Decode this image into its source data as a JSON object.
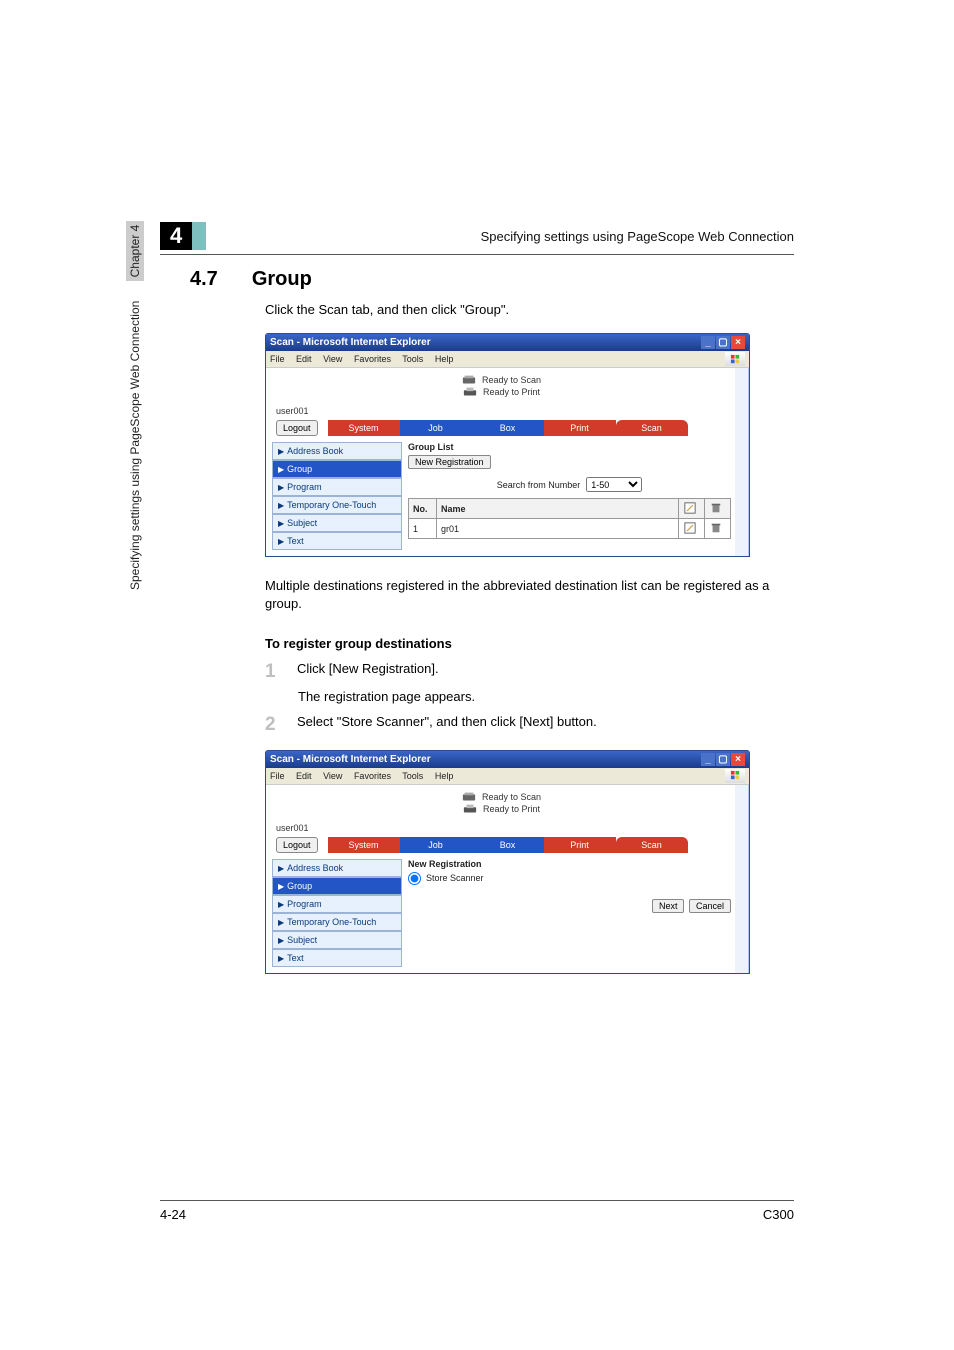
{
  "page": {
    "chapter_num": "4",
    "header_title": "Specifying settings using PageScope Web Connection",
    "footer_left": "4-24",
    "footer_right": "C300",
    "side_tab_text": "Specifying settings using PageScope Web Connection",
    "side_chapter": "Chapter 4"
  },
  "section": {
    "num": "4.7",
    "title": "Group",
    "intro": "Click the Scan tab, and then click \"Group\".",
    "mid_text": "Multiple destinations registered in the abbreviated destination list can be registered as a group.",
    "subhead": "To register group destinations",
    "steps": {
      "s1_num": "1",
      "s1": "Click [New Registration].",
      "s1_after": "The registration page appears.",
      "s2_num": "2",
      "s2": "Select \"Store Scanner\", and then click [Next] button."
    }
  },
  "ie_common": {
    "title": "Scan - Microsoft Internet Explorer",
    "menus": {
      "file": "File",
      "edit": "Edit",
      "view": "View",
      "favorites": "Favorites",
      "tools": "Tools",
      "help": "Help"
    },
    "status_scan": "Ready to Scan",
    "status_print": "Ready to Print",
    "user": "user001",
    "logout": "Logout",
    "tabs": {
      "system": "System",
      "job": "Job",
      "box": "Box",
      "print": "Print",
      "scan": "Scan"
    },
    "sidenav": {
      "addressbook": "Address Book",
      "group": "Group",
      "program": "Program",
      "temp": "Temporary One-Touch",
      "subject": "Subject",
      "text": "Text"
    }
  },
  "ie1": {
    "ptitle": "Group List",
    "newreg": "New Registration",
    "search_label": "Search from Number",
    "search_sel": "1-50",
    "th_no": "No.",
    "th_name": "Name",
    "row": {
      "no": "1",
      "name": "gr01"
    }
  },
  "ie2": {
    "ptitle": "New Registration",
    "radio": "Store Scanner",
    "btn_next": "Next",
    "btn_cancel": "Cancel"
  }
}
